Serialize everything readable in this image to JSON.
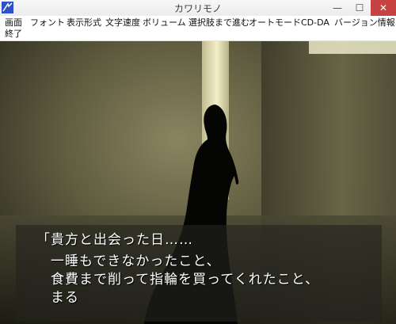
{
  "window": {
    "title": "カワリモノ",
    "minimize_glyph": "—",
    "maximize_glyph": "☐",
    "close_glyph": "✕"
  },
  "menu": {
    "items": [
      "画面",
      "フォント",
      "表示形式",
      "文字速度",
      "ボリューム",
      "選択肢まで進む",
      "オートモード",
      "CD-DA",
      "バージョン情報",
      "終了"
    ]
  },
  "dialogue": {
    "lines": [
      "「貴方と出会った日……",
      "　一睡もできなかったこと、",
      "　食費まで削って指輪を買ってくれたこと、",
      "　まる"
    ]
  },
  "colors": {
    "close_button": "#c74343",
    "scene_tint": "#8a8560"
  },
  "icons": {
    "app": "app-icon"
  }
}
